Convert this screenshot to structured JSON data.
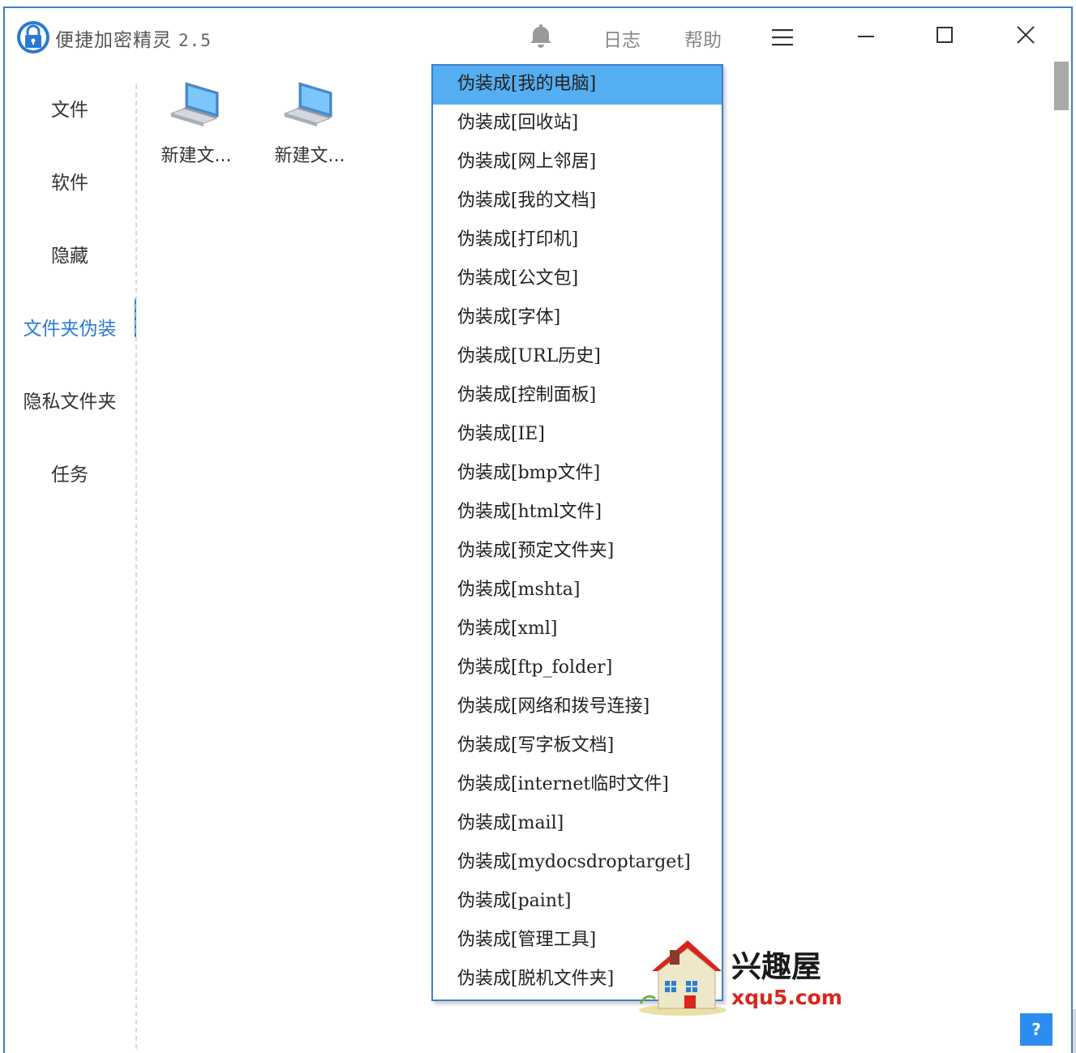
{
  "app": {
    "title": "便捷加密精灵",
    "version": "2.5"
  },
  "header": {
    "log_label": "日志",
    "help_label": "帮助"
  },
  "sidebar": {
    "items": [
      {
        "label": "文件"
      },
      {
        "label": "软件"
      },
      {
        "label": "隐藏"
      },
      {
        "label": "文件夹伪装"
      },
      {
        "label": "隐私文件夹"
      },
      {
        "label": "任务"
      }
    ],
    "active_index": 3
  },
  "folders": [
    {
      "label": "新建文..."
    },
    {
      "label": "新建文..."
    }
  ],
  "dropdown": {
    "selected_index": 0,
    "items": [
      "伪装成[我的电脑]",
      "伪装成[回收站]",
      "伪装成[网上邻居]",
      "伪装成[我的文档]",
      "伪装成[打印机]",
      "伪装成[公文包]",
      "伪装成[字体]",
      "伪装成[URL历史]",
      "伪装成[控制面板]",
      "伪装成[IE]",
      "伪装成[bmp文件]",
      "伪装成[html文件]",
      "伪装成[预定文件夹]",
      "伪装成[mshta]",
      "伪装成[xml]",
      "伪装成[ftp_folder]",
      "伪装成[网络和拨号连接]",
      "伪装成[写字板文档]",
      "伪装成[internet临时文件]",
      "伪装成[mail]",
      "伪装成[mydocsdroptarget]",
      "伪装成[paint]",
      "伪装成[管理工具]",
      "伪装成[脱机文件夹]"
    ]
  },
  "watermark": {
    "name": "兴趣屋",
    "url": "xqu5.com"
  },
  "help_button": {
    "label": "?"
  },
  "colors": {
    "accent": "#2a7ad5",
    "selected": "#55aef1",
    "border": "#3d7ecb",
    "watermark_red": "#d9251d"
  }
}
